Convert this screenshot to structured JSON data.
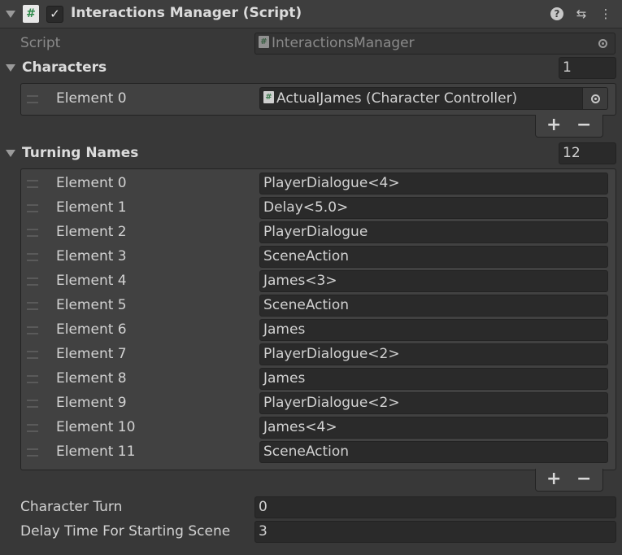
{
  "component": {
    "title": "Interactions Manager (Script)",
    "icons": [
      "help-icon",
      "preset-icon",
      "more-menu-icon"
    ]
  },
  "script_field": {
    "label": "Script",
    "value": "InteractionsManager"
  },
  "characters": {
    "label": "Characters",
    "size": "1",
    "elements": [
      {
        "label": "Element 0",
        "value": "ActualJames (Character Controller)"
      }
    ]
  },
  "turning_names": {
    "label": "Turning Names",
    "size": "12",
    "elements": [
      {
        "label": "Element 0",
        "value": "PlayerDialogue<4>"
      },
      {
        "label": "Element 1",
        "value": "Delay<5.0>"
      },
      {
        "label": "Element 2",
        "value": "PlayerDialogue"
      },
      {
        "label": "Element 3",
        "value": "SceneAction"
      },
      {
        "label": "Element 4",
        "value": "James<3>"
      },
      {
        "label": "Element 5",
        "value": "SceneAction"
      },
      {
        "label": "Element 6",
        "value": "James"
      },
      {
        "label": "Element 7",
        "value": "PlayerDialogue<2>"
      },
      {
        "label": "Element 8",
        "value": "James"
      },
      {
        "label": "Element 9",
        "value": "PlayerDialogue<2>"
      },
      {
        "label": "Element 10",
        "value": "James<4>"
      },
      {
        "label": "Element 11",
        "value": "SceneAction"
      }
    ]
  },
  "character_turn": {
    "label": "Character Turn",
    "value": "0"
  },
  "delay_time": {
    "label": "Delay Time For Starting Scene",
    "value": "3"
  },
  "list_buttons": {
    "add": "+",
    "remove": "−"
  },
  "glyphs": {
    "checkmark": "✓",
    "script_hash": "#",
    "help": "?",
    "preset": "⇆",
    "more": "⋮"
  }
}
